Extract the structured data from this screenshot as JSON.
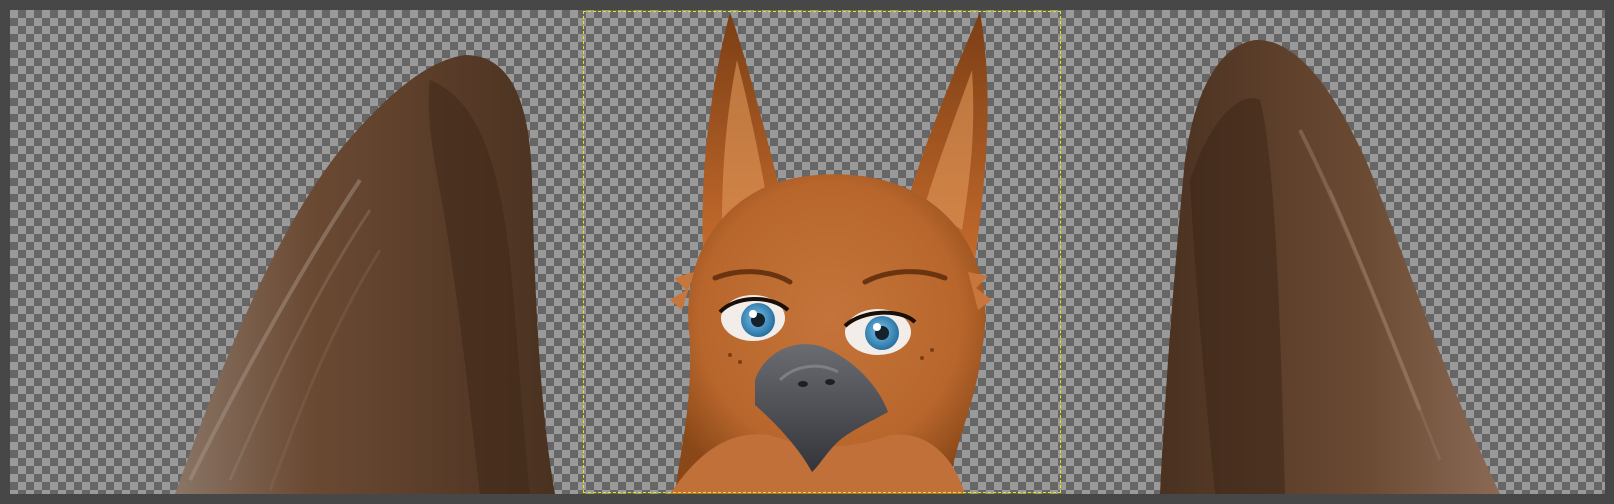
{
  "app": {
    "type": "image-editor-canvas"
  },
  "canvas": {
    "background": "transparency-checkerboard",
    "checker_colors": [
      "#9a9a9a",
      "#666666"
    ],
    "workspace_color": "#474747"
  },
  "artwork": {
    "subject": "griffin",
    "palette": {
      "wing_dark": "#4a3120",
      "wing_mid": "#6b4a33",
      "wing_light": "#8a6a55",
      "fur_dark": "#7a3e15",
      "fur_mid": "#b8662c",
      "fur_light": "#d8894a",
      "eye_blue": "#3d93c8",
      "beak": "#4b4c52"
    },
    "icons": {
      "left_wing": "left-wing",
      "right_wing": "right-wing",
      "head": "griffin-head"
    }
  },
  "selection": {
    "style": "marching-ants",
    "color": "#e8e800"
  }
}
